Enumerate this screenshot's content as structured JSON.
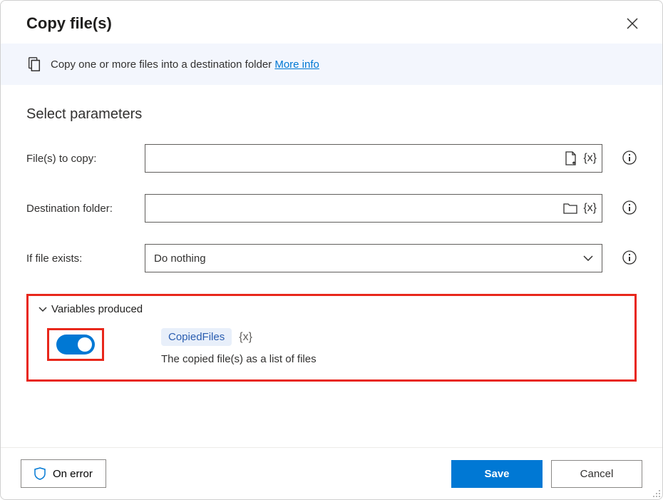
{
  "header": {
    "title": "Copy file(s)"
  },
  "infoBar": {
    "text": "Copy one or more files into a destination folder ",
    "linkText": "More info"
  },
  "section": {
    "heading": "Select parameters"
  },
  "fields": {
    "filesToCopy": {
      "label": "File(s) to copy:",
      "value": ""
    },
    "destinationFolder": {
      "label": "Destination folder:",
      "value": ""
    },
    "ifFileExists": {
      "label": "If file exists:",
      "selected": "Do nothing"
    }
  },
  "variablesProduced": {
    "headerText": "Variables produced",
    "toggleOn": true,
    "varName": "CopiedFiles",
    "varBrace": "{x}",
    "description": "The copied file(s) as a list of files"
  },
  "footer": {
    "onError": "On error",
    "save": "Save",
    "cancel": "Cancel"
  }
}
